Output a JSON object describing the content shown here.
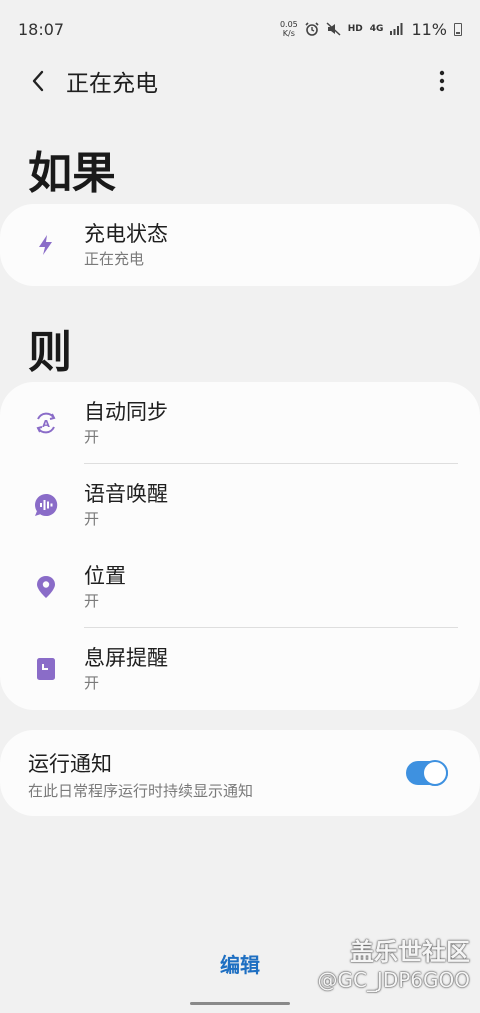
{
  "status_bar": {
    "time": "18:07",
    "speed_value": "0.05",
    "speed_unit": "K/s",
    "network_hd": "HD",
    "network_4g": "4G",
    "battery": "11%"
  },
  "app_bar": {
    "title": "正在充电"
  },
  "if_section": {
    "heading": "如果",
    "items": [
      {
        "title": "充电状态",
        "subtitle": "正在充电",
        "icon": "lightning-icon"
      }
    ]
  },
  "then_section": {
    "heading": "则",
    "items": [
      {
        "title": "自动同步",
        "subtitle": "开",
        "icon": "auto-sync-icon"
      },
      {
        "title": "语音唤醒",
        "subtitle": "开",
        "icon": "voice-wakeup-icon"
      },
      {
        "title": "位置",
        "subtitle": "开",
        "icon": "location-icon"
      },
      {
        "title": "息屏提醒",
        "subtitle": "开",
        "icon": "always-on-display-icon"
      }
    ]
  },
  "notification": {
    "title": "运行通知",
    "subtitle": "在此日常程序运行时持续显示通知",
    "enabled": true
  },
  "footer": {
    "edit_label": "编辑"
  },
  "watermark": {
    "line1": "盖乐世社区",
    "line2": "@GC_JDP6GOO"
  },
  "colors": {
    "accent": "#3e91e0",
    "icon_purple": "#8a6cc8",
    "edit_blue": "#1e6fc2",
    "background": "#f1f1f1",
    "card": "#fcfcfc"
  }
}
